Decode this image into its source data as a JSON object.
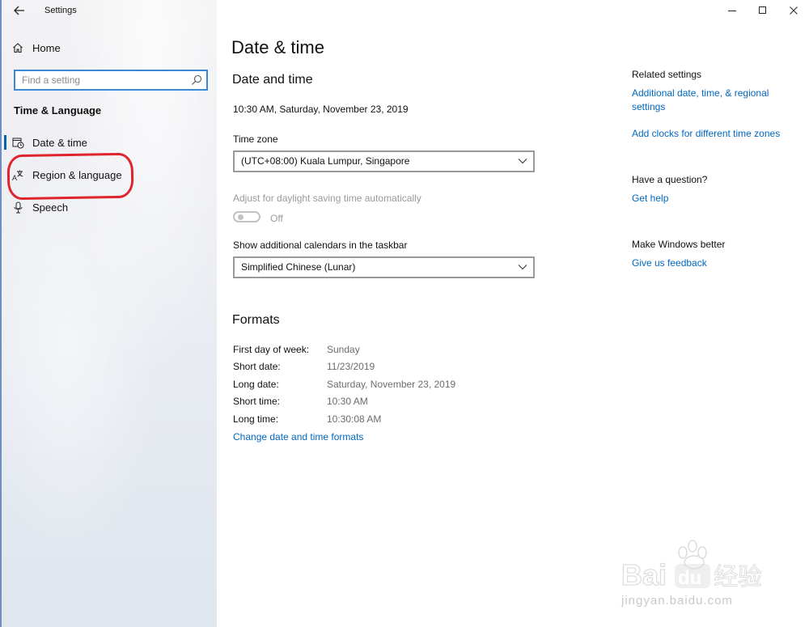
{
  "window": {
    "title": "Settings"
  },
  "sidebar": {
    "home_label": "Home",
    "search_placeholder": "Find a setting",
    "section_label": "Time & Language",
    "items": [
      {
        "label": "Date & time",
        "icon": "calendar-clock-icon",
        "selected": true
      },
      {
        "label": "Region & language",
        "icon": "language-icon",
        "selected": false
      },
      {
        "label": "Speech",
        "icon": "microphone-icon",
        "selected": false
      }
    ]
  },
  "main": {
    "page_title": "Date & time",
    "section_title": "Date and time",
    "current_datetime": "10:30 AM, Saturday, November 23, 2019",
    "timezone_label": "Time zone",
    "timezone_value": "(UTC+08:00) Kuala Lumpur, Singapore",
    "dst_label": "Adjust for daylight saving time automatically",
    "dst_state": "Off",
    "calendars_label": "Show additional calendars in the taskbar",
    "calendars_value": "Simplified Chinese (Lunar)",
    "formats_title": "Formats",
    "formats": [
      {
        "key": "First day of week:",
        "value": "Sunday"
      },
      {
        "key": "Short date:",
        "value": "11/23/2019"
      },
      {
        "key": "Long date:",
        "value": "Saturday, November 23, 2019"
      },
      {
        "key": "Short time:",
        "value": "10:30 AM"
      },
      {
        "key": "Long time:",
        "value": "10:30:08 AM"
      }
    ],
    "change_formats_link": "Change date and time formats"
  },
  "right_panel": {
    "related_title": "Related settings",
    "related_link1_line1": "Additional date, time, & regional",
    "related_link1_line2": "settings",
    "related_link2": "Add clocks for different time zones",
    "question_title": "Have a question?",
    "get_help": "Get help",
    "better_title": "Make Windows better",
    "feedback_link": "Give us feedback"
  },
  "watermark": {
    "logo": "Bai du 经验",
    "url": "jingyan.baidu.com"
  },
  "colors": {
    "accent": "#0067c0",
    "highlight": "#e0242c",
    "search_border": "#3a88d8"
  }
}
